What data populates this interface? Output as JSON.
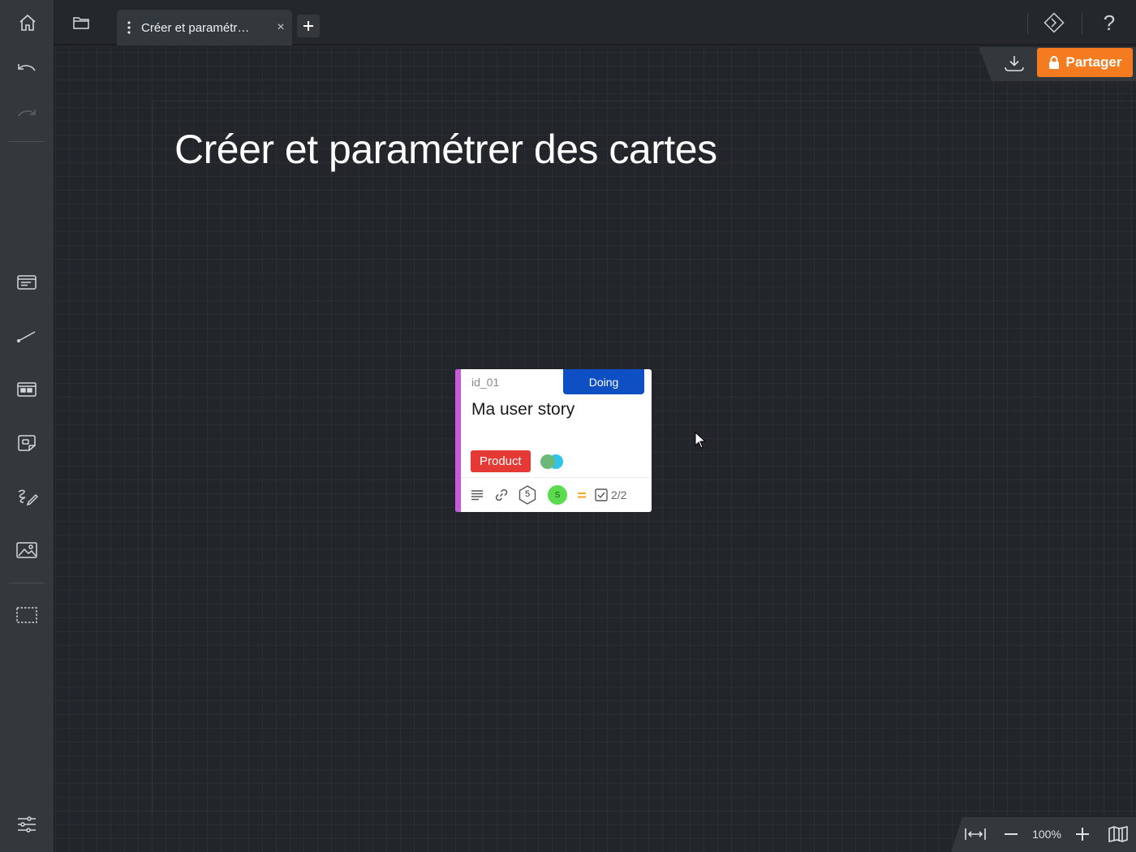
{
  "tab": {
    "label": "Créer et paramétr…",
    "close": "×"
  },
  "topbar": {
    "add": "+",
    "help": "?"
  },
  "board": {
    "title": "Créer et paramétrer des cartes"
  },
  "share": {
    "label": "Partager"
  },
  "card": {
    "id": "id_01",
    "status": "Doing",
    "title": "Ma user story",
    "tag": "Product",
    "estimate": "5",
    "assignee_initial": "S",
    "checklist": "2/2",
    "colors": {
      "stripe": "#c65ad8",
      "status": "#0f4fc4",
      "tag": "#e53935",
      "priority": "#f5a623"
    }
  },
  "zoom": {
    "level": "100%"
  },
  "icons": {
    "sidebar": [
      "home-icon",
      "undo-icon",
      "redo-icon",
      "card-icon",
      "connector-icon",
      "template-icon",
      "sticky-icon",
      "draw-icon",
      "image-icon",
      "frame-icon",
      "settings-icon"
    ],
    "topbar": [
      "folder-icon",
      "tab-menu-icon",
      "close-icon",
      "plus-icon",
      "diamond-icon",
      "help-icon",
      "download-icon",
      "lock-icon"
    ],
    "zoom": [
      "fit-width-icon",
      "zoom-out-icon",
      "zoom-in-icon",
      "map-icon"
    ]
  },
  "accent": "#f47b20"
}
